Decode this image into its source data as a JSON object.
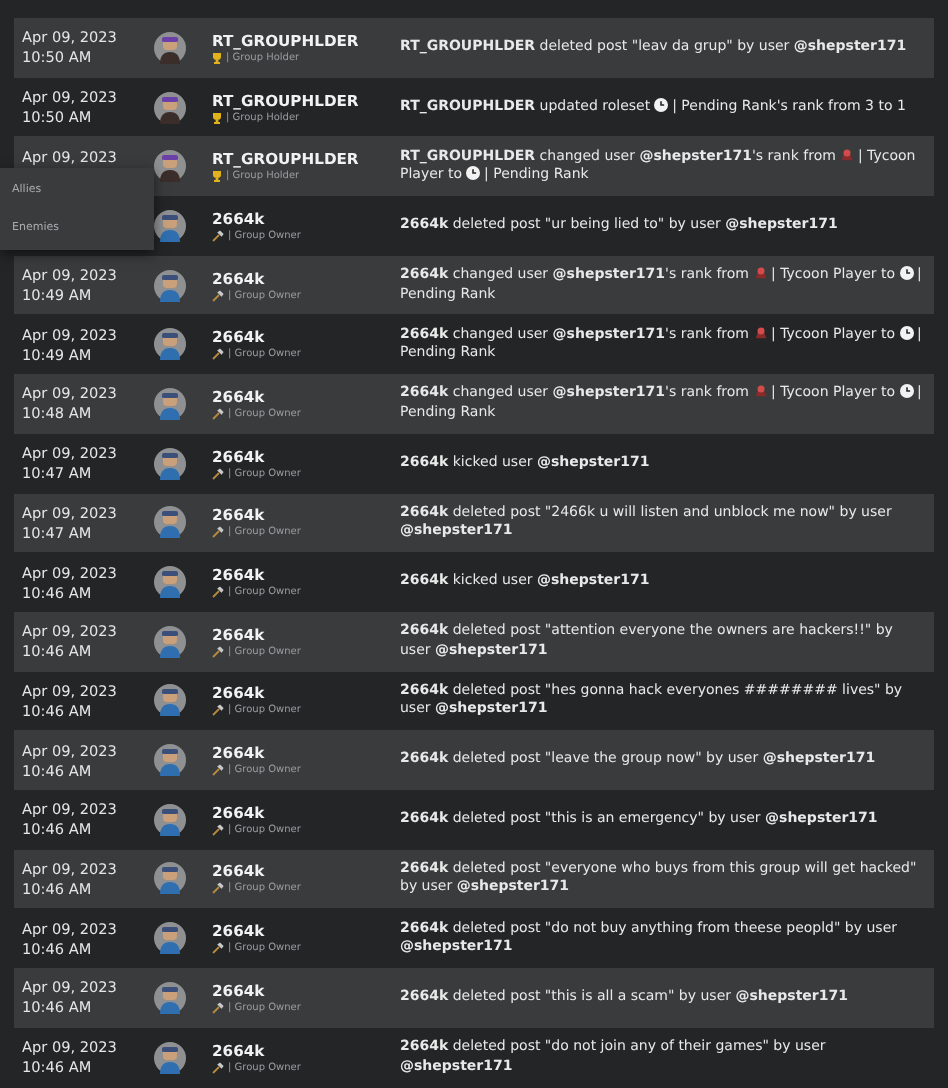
{
  "rows": [
    {
      "date": "Apr 09, 2023",
      "time": "10:50 AM",
      "user": "RT_GROUPHLDER",
      "kind": "holder",
      "role": "| Group Holder",
      "description": [
        {
          "kind": "text",
          "text": "**RT_GROUPHLDER** deleted post \"leav da grup\" by user **@shepster171**"
        }
      ]
    },
    {
      "date": "Apr 09, 2023",
      "time": "10:50 AM",
      "user": "RT_GROUPHLDER",
      "kind": "holder",
      "role": "| Group Holder",
      "description": [
        {
          "kind": "text",
          "text": "**RT_GROUPHLDER** updated roleset"
        },
        {
          "kind": "clock"
        },
        {
          "kind": "text",
          "text": "| Pending Rank's rank from 3 to 1"
        }
      ]
    },
    {
      "date": "Apr 09, 2023",
      "user": "RT_GROUPHLDER",
      "kind": "holder",
      "role": "| Group Holder",
      "description": [
        {
          "kind": "text",
          "text": "**RT_GROUPHLDER** changed user **@shepster171**'s rank from"
        },
        {
          "kind": "rank"
        },
        {
          "kind": "text",
          "text": "| Tycoon Player to"
        },
        {
          "kind": "clock"
        },
        {
          "kind": "text",
          "text": "| Pending Rank"
        }
      ]
    },
    {
      "user": "2664k",
      "kind": "owner",
      "role": "| Group Owner",
      "description": [
        {
          "kind": "text",
          "text": "**2664k** deleted post \"ur being lied to\" by user **@shepster171**"
        }
      ]
    },
    {
      "date": "Apr 09, 2023",
      "time": "10:49 AM",
      "user": "2664k",
      "kind": "owner",
      "role": "| Group Owner",
      "description": [
        {
          "kind": "text",
          "text": "**2664k** changed user **@shepster171**'s rank from"
        },
        {
          "kind": "rank"
        },
        {
          "kind": "text",
          "text": "| Tycoon Player to"
        },
        {
          "kind": "clock"
        },
        {
          "kind": "text",
          "text": "| Pending Rank"
        }
      ]
    },
    {
      "date": "Apr 09, 2023",
      "time": "10:49 AM",
      "user": "2664k",
      "kind": "owner",
      "role": "| Group Owner",
      "description": [
        {
          "kind": "text",
          "text": "**2664k** changed user **@shepster171**'s rank from"
        },
        {
          "kind": "rank"
        },
        {
          "kind": "text",
          "text": "| Tycoon Player to"
        },
        {
          "kind": "clock"
        },
        {
          "kind": "text",
          "text": "| Pending Rank"
        }
      ]
    },
    {
      "date": "Apr 09, 2023",
      "time": "10:48 AM",
      "user": "2664k",
      "kind": "owner",
      "role": "| Group Owner",
      "description": [
        {
          "kind": "text",
          "text": "**2664k** changed user **@shepster171**'s rank from"
        },
        {
          "kind": "rank"
        },
        {
          "kind": "text",
          "text": "| Tycoon Player to"
        },
        {
          "kind": "clock"
        },
        {
          "kind": "text",
          "text": "| Pending Rank"
        }
      ]
    },
    {
      "date": "Apr 09, 2023",
      "time": "10:47 AM",
      "user": "2664k",
      "kind": "owner",
      "role": "| Group Owner",
      "description": [
        {
          "kind": "text",
          "text": "**2664k** kicked user **@shepster171**"
        }
      ]
    },
    {
      "date": "Apr 09, 2023",
      "time": "10:47 AM",
      "user": "2664k",
      "kind": "owner",
      "role": "| Group Owner",
      "description": [
        {
          "kind": "text",
          "text": "**2664k** deleted post \"2466k u will listen and unblock me now\" by user **@shepster171**"
        }
      ]
    },
    {
      "date": "Apr 09, 2023",
      "time": "10:46 AM",
      "user": "2664k",
      "kind": "owner",
      "role": "| Group Owner",
      "description": [
        {
          "kind": "text",
          "text": "**2664k** kicked user **@shepster171**"
        }
      ]
    },
    {
      "date": "Apr 09, 2023",
      "time": "10:46 AM",
      "user": "2664k",
      "kind": "owner",
      "role": "| Group Owner",
      "description": [
        {
          "kind": "text",
          "text": "**2664k** deleted post \"attention everyone the owners are hackers!!\" by user **@shepster171**"
        }
      ]
    },
    {
      "date": "Apr 09, 2023",
      "time": "10:46 AM",
      "user": "2664k",
      "kind": "owner",
      "role": "| Group Owner",
      "description": [
        {
          "kind": "text",
          "text": "**2664k** deleted post \"hes gonna hack everyones ######## lives\" by user **@shepster171**"
        }
      ]
    },
    {
      "date": "Apr 09, 2023",
      "time": "10:46 AM",
      "user": "2664k",
      "kind": "owner",
      "role": "| Group Owner",
      "description": [
        {
          "kind": "text",
          "text": "**2664k** deleted post \"leave the group now\" by user **@shepster171**"
        }
      ]
    },
    {
      "date": "Apr 09, 2023",
      "time": "10:46 AM",
      "user": "2664k",
      "kind": "owner",
      "role": "| Group Owner",
      "description": [
        {
          "kind": "text",
          "text": "**2664k** deleted post \"this is an emergency\" by user **@shepster171**"
        }
      ]
    },
    {
      "date": "Apr 09, 2023",
      "time": "10:46 AM",
      "user": "2664k",
      "kind": "owner",
      "role": "| Group Owner",
      "description": [
        {
          "kind": "text",
          "text": "**2664k** deleted post \"everyone who buys from this group will get hacked\" by user **@shepster171**"
        }
      ]
    },
    {
      "date": "Apr 09, 2023",
      "time": "10:46 AM",
      "user": "2664k",
      "kind": "owner",
      "role": "| Group Owner",
      "description": [
        {
          "kind": "text",
          "text": "**2664k** deleted post \"do not buy anything from theese peopld\" by user **@shepster171**"
        }
      ]
    },
    {
      "date": "Apr 09, 2023",
      "time": "10:46 AM",
      "user": "2664k",
      "kind": "owner",
      "role": "| Group Owner",
      "description": [
        {
          "kind": "text",
          "text": "**2664k** deleted post \"this is all a scam\" by user **@shepster171**"
        }
      ]
    },
    {
      "date": "Apr 09, 2023",
      "time": "10:46 AM",
      "user": "2664k",
      "kind": "owner",
      "role": "| Group Owner",
      "description": [
        {
          "kind": "text",
          "text": "**2664k** deleted post \"do not join any of their games\" by user **@shepster171**"
        }
      ]
    }
  ],
  "menu": {
    "items": [
      "Allies",
      "Enemies"
    ]
  }
}
